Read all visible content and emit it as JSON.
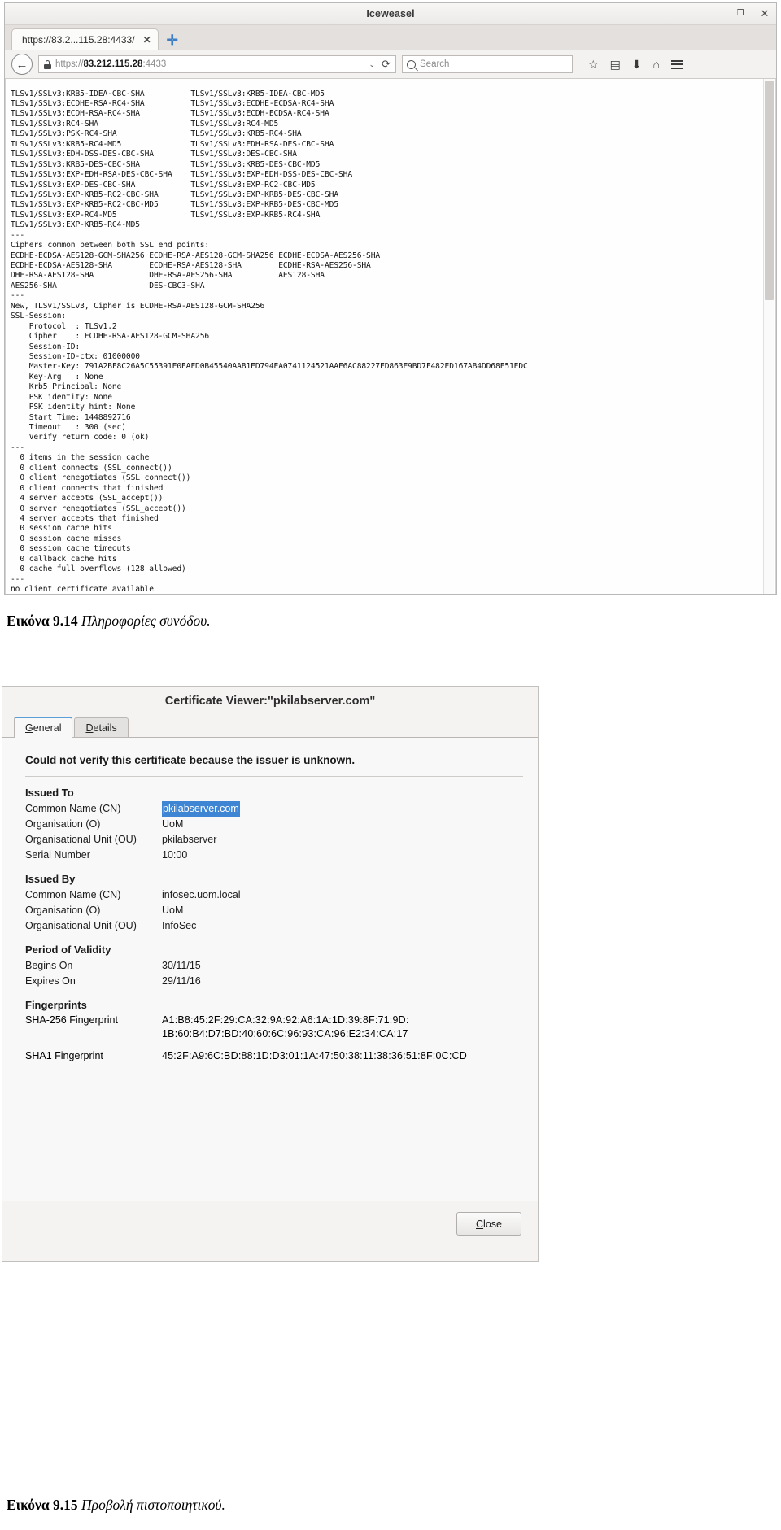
{
  "browser": {
    "window_title": "Iceweasel",
    "window_buttons": {
      "minimize": "–",
      "maximize": "❐",
      "close": "✕"
    },
    "tab": {
      "label": "https://83.2...115.28:4433/",
      "close_label": "✕"
    },
    "new_tab_label": "✛",
    "back_label": "←",
    "url_display": {
      "scheme": "https://",
      "host": "83.212.115.28",
      "port": ":4433"
    },
    "url_dropdown_label": "⌄",
    "reload_label": "⟳",
    "search_placeholder": "Search",
    "toolbar_icons": {
      "bookmark": "☆",
      "reader": "▤",
      "downloads": "⬇",
      "home": "⌂"
    }
  },
  "terminal": {
    "content": "TLSv1/SSLv3:KRB5-IDEA-CBC-SHA          TLSv1/SSLv3:KRB5-IDEA-CBC-MD5\nTLSv1/SSLv3:ECDHE-RSA-RC4-SHA          TLSv1/SSLv3:ECDHE-ECDSA-RC4-SHA\nTLSv1/SSLv3:ECDH-RSA-RC4-SHA           TLSv1/SSLv3:ECDH-ECDSA-RC4-SHA\nTLSv1/SSLv3:RC4-SHA                    TLSv1/SSLv3:RC4-MD5\nTLSv1/SSLv3:PSK-RC4-SHA                TLSv1/SSLv3:KRB5-RC4-SHA\nTLSv1/SSLv3:KRB5-RC4-MD5               TLSv1/SSLv3:EDH-RSA-DES-CBC-SHA\nTLSv1/SSLv3:EDH-DSS-DES-CBC-SHA        TLSv1/SSLv3:DES-CBC-SHA\nTLSv1/SSLv3:KRB5-DES-CBC-SHA           TLSv1/SSLv3:KRB5-DES-CBC-MD5\nTLSv1/SSLv3:EXP-EDH-RSA-DES-CBC-SHA    TLSv1/SSLv3:EXP-EDH-DSS-DES-CBC-SHA\nTLSv1/SSLv3:EXP-DES-CBC-SHA            TLSv1/SSLv3:EXP-RC2-CBC-MD5\nTLSv1/SSLv3:EXP-KRB5-RC2-CBC-SHA       TLSv1/SSLv3:EXP-KRB5-DES-CBC-SHA\nTLSv1/SSLv3:EXP-KRB5-RC2-CBC-MD5       TLSv1/SSLv3:EXP-KRB5-DES-CBC-MD5\nTLSv1/SSLv3:EXP-RC4-MD5                TLSv1/SSLv3:EXP-KRB5-RC4-SHA\nTLSv1/SSLv3:EXP-KRB5-RC4-MD5\n---\nCiphers common between both SSL end points:\nECDHE-ECDSA-AES128-GCM-SHA256 ECDHE-RSA-AES128-GCM-SHA256 ECDHE-ECDSA-AES256-SHA\nECDHE-ECDSA-AES128-SHA        ECDHE-RSA-AES128-SHA        ECDHE-RSA-AES256-SHA\nDHE-RSA-AES128-SHA            DHE-RSA-AES256-SHA          AES128-SHA\nAES256-SHA                    DES-CBC3-SHA\n---\nNew, TLSv1/SSLv3, Cipher is ECDHE-RSA-AES128-GCM-SHA256\nSSL-Session:\n    Protocol  : TLSv1.2\n    Cipher    : ECDHE-RSA-AES128-GCM-SHA256\n    Session-ID:\n    Session-ID-ctx: 01000000\n    Master-Key: 791A2BF8C26A5C55391E0EAFD0B45540AAB1ED794EA0741124521AAF6AC88227ED863E9BD7F482ED167AB4DD68F51EDC\n    Key-Arg   : None\n    Krb5 Principal: None\n    PSK identity: None\n    PSK identity hint: None\n    Start Time: 1448892716\n    Timeout   : 300 (sec)\n    Verify return code: 0 (ok)\n---\n  0 items in the session cache\n  0 client connects (SSL_connect())\n  0 client renegotiates (SSL_connect())\n  0 client connects that finished\n  4 server accepts (SSL_accept())\n  0 server renegotiates (SSL_accept())\n  4 server accepts that finished\n  0 session cache hits\n  0 session cache misses\n  0 session cache timeouts\n  0 callback cache hits\n  0 cache full overflows (128 allowed)\n---\nno client certificate available"
  },
  "captions": {
    "fig_9_14_bold": "Εικόνα 9.14",
    "fig_9_14_italic": "Πληροφορίες συνόδου.",
    "fig_9_15_bold": "Εικόνα 9.15",
    "fig_9_15_italic": "Προβολή πιστοποιητικού."
  },
  "cert_dialog": {
    "title": "Certificate Viewer:\"pkilabserver.com\"",
    "tabs": [
      {
        "label": "General",
        "mnemonic": "G",
        "rest": "eneral",
        "active": true
      },
      {
        "label": "Details",
        "mnemonic": "D",
        "rest": "etails",
        "active": false
      }
    ],
    "warning": "Could not verify this certificate because the issuer is unknown.",
    "sections": [
      {
        "heading": "Issued To",
        "rows": [
          {
            "label": "Common Name (CN)",
            "value": "pkilabserver.com",
            "highlighted": true
          },
          {
            "label": "Organisation (O)",
            "value": "UoM",
            "highlighted": false
          },
          {
            "label": "Organisational Unit (OU)",
            "value": "pkilabserver",
            "highlighted": false
          },
          {
            "label": "Serial Number",
            "value": "10:00",
            "highlighted": false
          }
        ]
      },
      {
        "heading": "Issued By",
        "rows": [
          {
            "label": "Common Name (CN)",
            "value": "infosec.uom.local",
            "highlighted": false
          },
          {
            "label": "Organisation (O)",
            "value": "UoM",
            "highlighted": false
          },
          {
            "label": "Organisational Unit (OU)",
            "value": "InfoSec",
            "highlighted": false
          }
        ]
      },
      {
        "heading": "Period of Validity",
        "rows": [
          {
            "label": "Begins On",
            "value": "30/11/15",
            "highlighted": false
          },
          {
            "label": "Expires On",
            "value": "29/11/16",
            "highlighted": false
          }
        ]
      }
    ],
    "fingerprints": {
      "heading": "Fingerprints",
      "sha256_label": "SHA-256 Fingerprint",
      "sha256_value": "A1:B8:45:2F:29:CA:32:9A:92:A6:1A:1D:39:8F:71:9D:\n1B:60:B4:D7:BD:40:60:6C:96:93:CA:96:E2:34:CA:17",
      "sha1_label": "SHA1 Fingerprint",
      "sha1_value": "45:2F:A9:6C:BD:88:1D:D3:01:1A:47:50:38:11:38:36:51:8F:0C:CD"
    },
    "close_button": {
      "mnemonic": "C",
      "rest": "lose"
    }
  }
}
